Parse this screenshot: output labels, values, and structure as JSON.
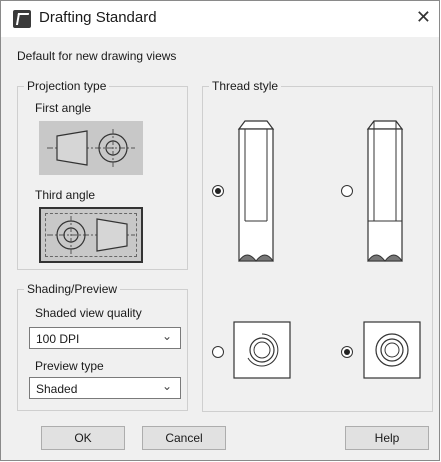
{
  "window": {
    "title": "Drafting Standard",
    "close_glyph": "✕"
  },
  "subtitle": "Default for new drawing views",
  "projection": {
    "legend": "Projection type",
    "first_angle": "First angle",
    "third_angle": "Third angle",
    "selected": "Third angle"
  },
  "shading": {
    "legend": "Shading/Preview",
    "quality_label": "Shaded view quality",
    "quality_value": "100 DPI",
    "preview_label": "Preview type",
    "preview_value": "Shaded"
  },
  "thread": {
    "legend": "Thread style",
    "selected_side": "1",
    "selected_end": "2"
  },
  "buttons": {
    "ok": "OK",
    "cancel": "Cancel",
    "help": "Help"
  },
  "icons": [
    "app-icon",
    "close-icon",
    "chevron-down-icon"
  ]
}
